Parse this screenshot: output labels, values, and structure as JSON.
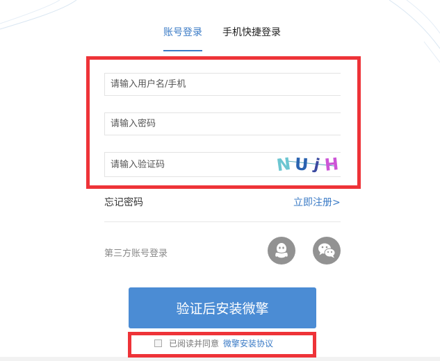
{
  "tabs": [
    {
      "label": "账号登录",
      "active": true
    },
    {
      "label": "手机快捷登录",
      "active": false
    }
  ],
  "fields": {
    "username_placeholder": "请输入用户名/手机",
    "password_placeholder": "请输入密码",
    "captcha_placeholder": "请输入验证码"
  },
  "captcha": {
    "chars": [
      "N",
      "U",
      "j",
      "H"
    ]
  },
  "links": {
    "forgot_password": "忘记密码",
    "register": "立即注册>"
  },
  "third_party": {
    "label": "第三方账号登录",
    "icons": [
      "qq-icon",
      "wechat-icon"
    ]
  },
  "submit_label": "验证后安装微擎",
  "agreement": {
    "text": "已阅读并同意",
    "link": "微擎安装协议",
    "checked": false
  },
  "colors": {
    "accent": "#3b7bc6",
    "button": "#4b8cd4",
    "highlight_box": "#ee3338",
    "social_icon_bg": "#929292"
  }
}
